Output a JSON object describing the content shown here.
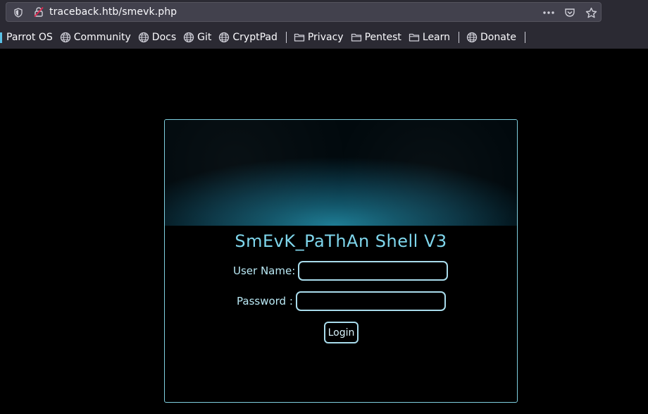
{
  "browser": {
    "url": "traceback.htb/smevk.php",
    "bookmarks": [
      {
        "label": "Parrot OS",
        "icon": "parrot-icon"
      },
      {
        "label": "Community",
        "icon": "globe-icon"
      },
      {
        "label": "Docs",
        "icon": "globe-icon"
      },
      {
        "label": "Git",
        "icon": "globe-icon"
      },
      {
        "label": "CryptPad",
        "icon": "globe-icon"
      },
      {
        "label": "Privacy",
        "icon": "folder-icon"
      },
      {
        "label": "Pentest",
        "icon": "folder-icon"
      },
      {
        "label": "Learn",
        "icon": "folder-icon"
      },
      {
        "label": "Donate",
        "icon": "globe-icon"
      }
    ]
  },
  "shell": {
    "title": "SmEvK_PaThAn Shell V3",
    "username_label": "User Name:",
    "username_value": "",
    "password_label": "Password :",
    "password_value": "",
    "login_label": "Login"
  },
  "colors": {
    "accent": "#7fd6ec",
    "border": "#a9dcec",
    "background": "#000000"
  }
}
